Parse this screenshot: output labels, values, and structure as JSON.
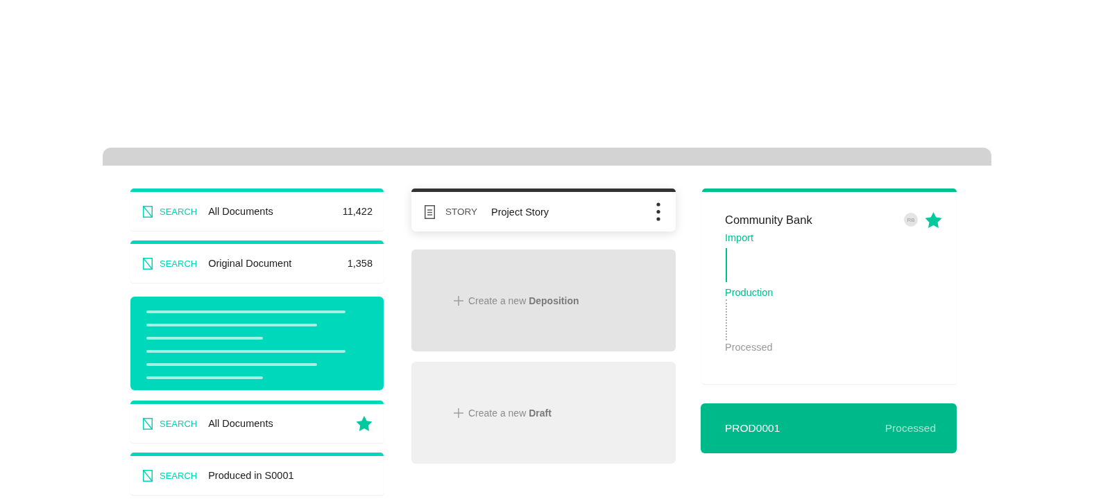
{
  "left_column": [
    {
      "kind": "search",
      "type_label": "SEARCH",
      "title": "All Documents",
      "count": "11,422",
      "starred": false
    },
    {
      "kind": "search",
      "type_label": "SEARCH",
      "title": "Original Document",
      "count": "1,358",
      "starred": false
    },
    {
      "kind": "preview"
    },
    {
      "kind": "search",
      "type_label": "SEARCH",
      "title": "All Documents",
      "starred": true
    },
    {
      "kind": "search",
      "type_label": "SEARCH",
      "title": "Produced in S0001",
      "starred": false
    }
  ],
  "story_card": {
    "type_label": "STORY",
    "title": "Project Story"
  },
  "create_cards": [
    {
      "text": "Create a new **Deposition**",
      "selected": true
    },
    {
      "text": "Create a new **Draft**",
      "selected": false
    }
  ],
  "production_card": {
    "title": "Community Bank",
    "avatar": "RB",
    "starred": true,
    "stages": [
      {
        "label": "Import",
        "completed": true
      },
      {
        "label": "Production",
        "completed": true
      },
      {
        "label": "Processed",
        "completed": false
      }
    ]
  },
  "status_bar": {
    "id": "PROD0001",
    "status": "Processed"
  }
}
